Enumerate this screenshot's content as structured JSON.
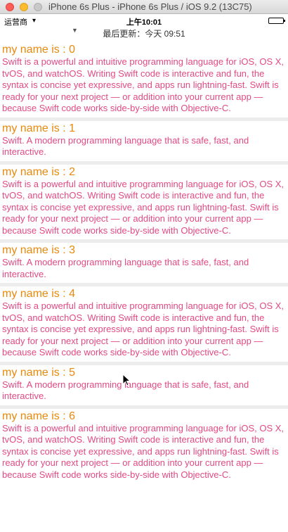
{
  "window": {
    "title": "iPhone 6s Plus - iPhone 6s Plus / iOS 9.2 (13C75)"
  },
  "status_bar": {
    "carrier": "运营商",
    "time": "上午10:01"
  },
  "refresh": {
    "text": "最后更新：今天 09:51"
  },
  "rows": [
    {
      "title": "my name is : 0",
      "body": "Swift is a powerful and intuitive programming language for iOS, OS X, tvOS, and watchOS. Writing Swift code is interactive and fun, the syntax is concise yet expressive, and apps run lightning-fast. Swift is ready for your next project — or addition into your current app — because Swift code works side-by-side with Objective-C."
    },
    {
      "title": "my name is : 1",
      "body": "Swift. A modern programming language that is safe, fast, and interactive."
    },
    {
      "title": "my name is : 2",
      "body": "Swift is a powerful and intuitive programming language for iOS, OS X, tvOS, and watchOS. Writing Swift code is interactive and fun, the syntax is concise yet expressive, and apps run lightning-fast. Swift is ready for your next project — or addition into your current app — because Swift code works side-by-side with Objective-C."
    },
    {
      "title": "my name is : 3",
      "body": "Swift. A modern programming language that is safe, fast, and interactive."
    },
    {
      "title": "my name is : 4",
      "body": "Swift is a powerful and intuitive programming language for iOS, OS X, tvOS, and watchOS. Writing Swift code is interactive and fun, the syntax is concise yet expressive, and apps run lightning-fast. Swift is ready for your next project — or addition into your current app — because Swift code works side-by-side with Objective-C."
    },
    {
      "title": "my name is : 5",
      "body": "Swift. A modern programming language that is safe, fast, and interactive."
    },
    {
      "title": "my name is : 6",
      "body": "Swift is a powerful and intuitive programming language for iOS, OS X, tvOS, and watchOS. Writing Swift code is interactive and fun, the syntax is concise yet expressive, and apps run lightning-fast. Swift is ready for your next project — or addition into your current app — because Swift code works side-by-side with Objective-C."
    }
  ],
  "colors": {
    "title": "#e8890c",
    "body": "#e24a83",
    "separator": "#ededed"
  }
}
